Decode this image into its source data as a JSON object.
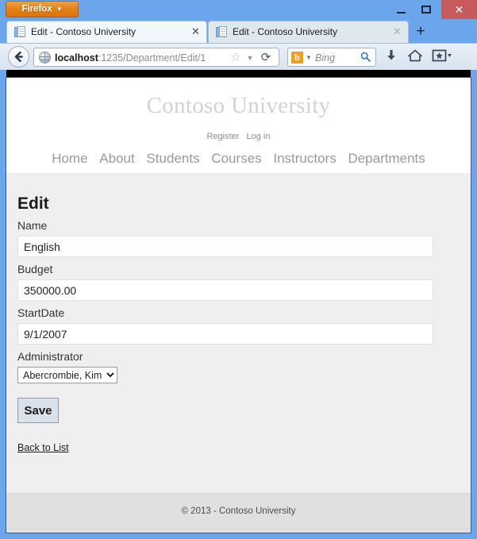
{
  "browser": {
    "app_button_label": "Firefox",
    "window_controls": {
      "minimize": "minimize-icon",
      "maximize": "maximize-icon",
      "close": "✕"
    },
    "tabs": [
      {
        "title": "Edit - Contoso University",
        "active": true,
        "close_label": "✕"
      },
      {
        "title": "Edit - Contoso University",
        "active": false,
        "close_label": "✕"
      }
    ],
    "new_tab_label": "+",
    "toolbar": {
      "back_label": "back-icon",
      "url_host": "localhost",
      "url_path": ":1235/Department/Edit/1",
      "url_full": "localhost:1235/Department/Edit/1",
      "star_label": "☆",
      "dropdown_label": "▼",
      "reload_label": "⟳",
      "search_engine": "b",
      "search_placeholder": "Bing",
      "search_go_label": "⚲",
      "download_label": "download-icon",
      "home_label": "home-icon",
      "bookmarks_label": "bookmarks-icon"
    }
  },
  "page": {
    "brand": "Contoso University",
    "account_links": [
      {
        "label": "Register"
      },
      {
        "label": "Log in"
      }
    ],
    "nav_links": [
      {
        "label": "Home"
      },
      {
        "label": "About"
      },
      {
        "label": "Students"
      },
      {
        "label": "Courses"
      },
      {
        "label": "Instructors"
      },
      {
        "label": "Departments"
      }
    ],
    "heading": "Edit",
    "fields": [
      {
        "label": "Name",
        "value": "English"
      },
      {
        "label": "Budget",
        "value": "350000.00"
      },
      {
        "label": "StartDate",
        "value": "9/1/2007"
      }
    ],
    "administrator": {
      "label": "Administrator",
      "selected": "Abercrombie, Kim",
      "options": [
        "Abercrombie, Kim"
      ]
    },
    "save_label": "Save",
    "back_to_list_label": "Back to List",
    "copyright": "© 2013 - Contoso University"
  },
  "colors": {
    "window_frame": "#6ba5ec",
    "firefox_orange": "#e57f18",
    "close_red": "#c75b5b",
    "body_gray": "#efefef",
    "footer_gray": "#e0e0e0",
    "brand_gray": "#d2d2d2"
  }
}
